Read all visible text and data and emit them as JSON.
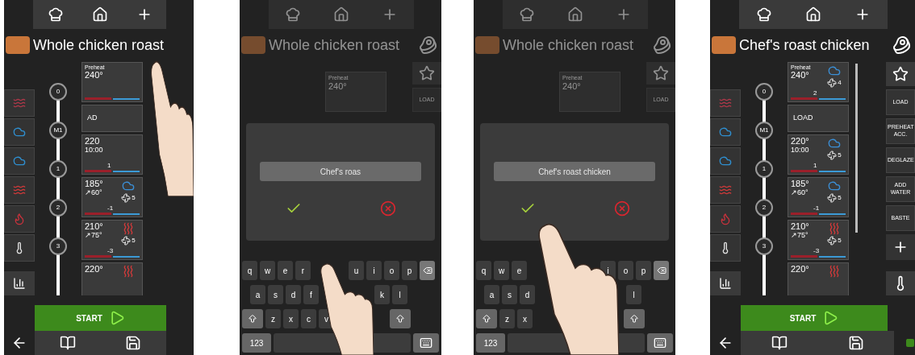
{
  "screens": [
    {
      "kind": "editor",
      "title": "Whole chicken roast",
      "modes": [
        {
          "kind": "heat",
          "color": "#b2384a"
        },
        {
          "kind": "steam",
          "color": "#2f8fd0"
        },
        {
          "kind": "combi",
          "color": "#2f8fd0"
        },
        {
          "kind": "heat",
          "color": "#d23a3a"
        },
        {
          "kind": "dry",
          "color": "#c8323c"
        },
        {
          "kind": "probe",
          "color": "#e0e0e0"
        }
      ],
      "timeline": [
        "0",
        "M1",
        "1",
        "2",
        "3"
      ],
      "cards": [
        {
          "kind": "step",
          "label": "Preheat",
          "temp": "240°"
        },
        {
          "kind": "action",
          "label": "AD"
        },
        {
          "kind": "step",
          "temp": "220",
          "time": "10:00",
          "delta": "1"
        },
        {
          "kind": "combi",
          "temp": "185°",
          "time": "↗60°",
          "fan": "5",
          "delta": "-1"
        },
        {
          "kind": "convection",
          "temp": "210°",
          "time": "↗75°",
          "fan": "5",
          "delta": "-3"
        },
        {
          "kind": "convection",
          "temp": "220°"
        }
      ],
      "start": "START"
    },
    {
      "kind": "rename",
      "title": "Whole chicken roast",
      "background_card": {
        "label": "Preheat",
        "temp": "240°"
      },
      "background_button": "LOAD",
      "field_value": "Chef's roas",
      "keyboard": [
        [
          {
            "kind": "key",
            "label": "q"
          },
          {
            "kind": "key",
            "label": "w"
          },
          {
            "kind": "key",
            "label": "e"
          },
          {
            "kind": "key",
            "label": "r"
          },
          {
            "kind": "covered"
          },
          {
            "kind": "covered"
          },
          {
            "kind": "key",
            "label": "u"
          },
          {
            "kind": "key",
            "label": "i"
          },
          {
            "kind": "key",
            "label": "o"
          },
          {
            "kind": "key",
            "label": "p"
          },
          {
            "kind": "backspace"
          }
        ],
        [
          {
            "kind": "key",
            "label": "a"
          },
          {
            "kind": "key",
            "label": "s"
          },
          {
            "kind": "key",
            "label": "d"
          },
          {
            "kind": "key",
            "label": "f"
          },
          {
            "kind": "covered"
          },
          {
            "kind": "covered"
          },
          {
            "kind": "covered"
          },
          {
            "kind": "key",
            "label": "k"
          },
          {
            "kind": "key",
            "label": "l"
          }
        ],
        [
          {
            "kind": "shift"
          },
          {
            "kind": "key",
            "label": "z"
          },
          {
            "kind": "key",
            "label": "x"
          },
          {
            "kind": "key",
            "label": "c"
          },
          {
            "kind": "key",
            "label": "v"
          },
          {
            "kind": "covered"
          },
          {
            "kind": "covered"
          },
          {
            "kind": "covered"
          },
          {
            "kind": "shift"
          }
        ],
        [
          {
            "kind": "mode",
            "label": "123"
          },
          {
            "kind": "space"
          },
          {
            "kind": "hide"
          }
        ]
      ]
    },
    {
      "kind": "rename",
      "title": "Whole chicken roast",
      "background_card": {
        "label": "Preheat",
        "temp": "240°"
      },
      "background_button": "LOAD",
      "field_value": "Chef's roast chicken",
      "keyboard": [
        [
          {
            "kind": "key",
            "label": "q"
          },
          {
            "kind": "key",
            "label": "w"
          },
          {
            "kind": "key",
            "label": "e"
          },
          {
            "kind": "covered"
          },
          {
            "kind": "covered"
          },
          {
            "kind": "covered"
          },
          {
            "kind": "covered"
          },
          {
            "kind": "key",
            "label": "i"
          },
          {
            "kind": "key",
            "label": "o"
          },
          {
            "kind": "key",
            "label": "p"
          },
          {
            "kind": "backspace"
          }
        ],
        [
          {
            "kind": "key",
            "label": "a"
          },
          {
            "kind": "key",
            "label": "s"
          },
          {
            "kind": "key",
            "label": "d"
          },
          {
            "kind": "covered"
          },
          {
            "kind": "covered"
          },
          {
            "kind": "covered"
          },
          {
            "kind": "covered"
          },
          {
            "kind": "covered"
          },
          {
            "kind": "key",
            "label": "l"
          }
        ],
        [
          {
            "kind": "shift"
          },
          {
            "kind": "key",
            "label": "z"
          },
          {
            "kind": "key",
            "label": "x"
          },
          {
            "kind": "covered"
          },
          {
            "kind": "covered"
          },
          {
            "kind": "covered"
          },
          {
            "kind": "covered"
          },
          {
            "kind": "covered"
          },
          {
            "kind": "shift"
          }
        ],
        [
          {
            "kind": "mode",
            "label": "123"
          },
          {
            "kind": "space"
          },
          {
            "kind": "hide"
          }
        ]
      ]
    },
    {
      "kind": "editor",
      "title": "Chef's roast chicken",
      "modes": [
        {
          "kind": "heat",
          "color": "#b2384a"
        },
        {
          "kind": "steam",
          "color": "#2f8fd0"
        },
        {
          "kind": "combi",
          "color": "#2f8fd0"
        },
        {
          "kind": "heat",
          "color": "#d23a3a"
        },
        {
          "kind": "dry",
          "color": "#c8323c"
        },
        {
          "kind": "probe",
          "color": "#e0e0e0"
        }
      ],
      "timeline": [
        "0",
        "M1",
        "1",
        "2",
        "3"
      ],
      "cards": [
        {
          "kind": "combi",
          "label": "Preheat",
          "temp": "240°",
          "fan": "4",
          "delta": "2"
        },
        {
          "kind": "action",
          "label": "LOAD"
        },
        {
          "kind": "combi",
          "temp": "220°",
          "time": "10:00",
          "fan": "5",
          "delta": "1"
        },
        {
          "kind": "combi",
          "temp": "185°",
          "time": "↗60°",
          "fan": "5",
          "delta": "-1"
        },
        {
          "kind": "convection",
          "temp": "210°",
          "time": "↗75°",
          "fan": "5",
          "delta": "-3"
        },
        {
          "kind": "convection",
          "temp": "220°"
        }
      ],
      "right_buttons": [
        "LOAD",
        "PREHEAT ACC.",
        "DEGLAZE",
        "ADD WATER",
        "BASTE"
      ],
      "start": "START"
    }
  ]
}
